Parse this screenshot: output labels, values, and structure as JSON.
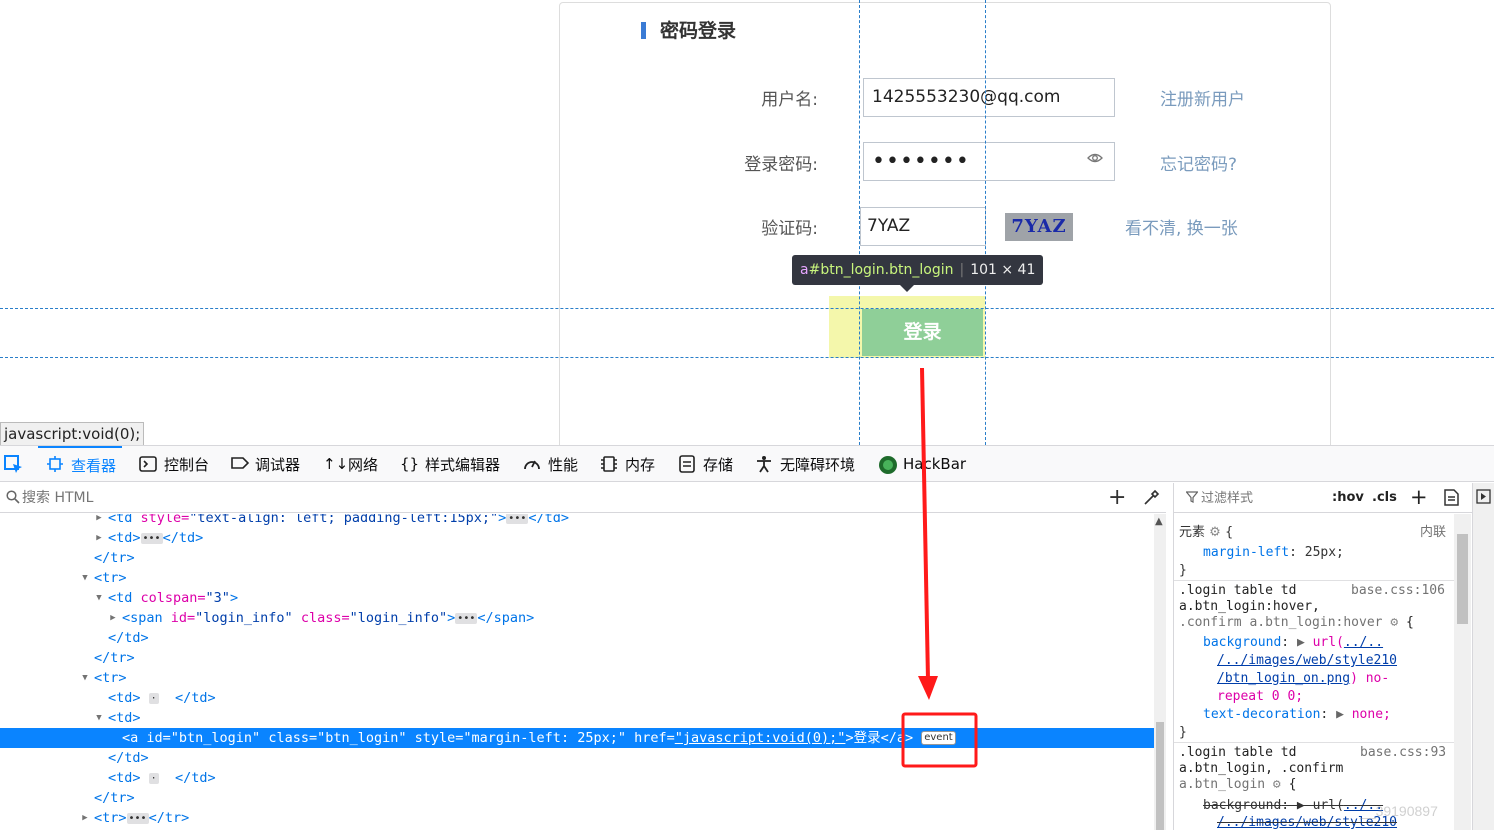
{
  "login_form": {
    "title": "密码登录",
    "username_label": "用户名:",
    "username_value": "1425553230@qq.com",
    "register_link": "注册新用户",
    "password_label": "登录密码:",
    "password_value": "•••••••",
    "forgot_link": "忘记密码?",
    "captcha_label": "验证码:",
    "captcha_value": "7YAZ",
    "captcha_image_text": "7YAZ",
    "refresh_link": "看不清, 换一张",
    "login_button": "登录"
  },
  "highlighter": {
    "tag": "a",
    "selector": "#btn_login.btn_login",
    "size": "101 × 41"
  },
  "status_url": "javascript:void(0);",
  "devtools": {
    "tabs": [
      {
        "label": "查看器",
        "icon": "inspector-icon"
      },
      {
        "label": "控制台",
        "icon": "console-icon"
      },
      {
        "label": "调试器",
        "icon": "debugger-icon"
      },
      {
        "label": "网络",
        "icon": "network-icon"
      },
      {
        "label": "样式编辑器",
        "icon": "style-editor-icon"
      },
      {
        "label": "性能",
        "icon": "performance-icon"
      },
      {
        "label": "内存",
        "icon": "memory-icon"
      },
      {
        "label": "存储",
        "icon": "storage-icon"
      },
      {
        "label": "无障碍环境",
        "icon": "accessibility-icon"
      },
      {
        "label": "HackBar",
        "icon": "hackbar-icon"
      }
    ],
    "search_placeholder": "搜索 HTML",
    "markup": {
      "l1": {
        "tag_open": "<td",
        "attr": " style=",
        "val": "\"text-align: left; padding-left:15px;\"",
        "close": ">",
        "end": "</td>"
      },
      "l2": {
        "open": "<td>",
        "end": "</td>"
      },
      "l3": "</tr>",
      "l4": "<tr>",
      "l5": {
        "tag_open": "<td",
        "attr": " colspan=",
        "val": "\"3\"",
        "close": ">"
      },
      "l6": {
        "tag_open": "<span",
        "a1": " id=",
        "v1": "\"login_info\"",
        "a2": " class=",
        "v2": "\"login_info\"",
        "close": ">",
        "end": "</span>"
      },
      "l7": "</td>",
      "l8": "</tr>",
      "l9": "<tr>",
      "l10": {
        "open": "<td>",
        "end": "</td>"
      },
      "l11": "<td>",
      "l12": {
        "tag_open": "<a",
        "a1": " id=",
        "v1": "\"btn_login\"",
        "a2": " class=",
        "v2": "\"btn_login\"",
        "a3": " style=",
        "v3": "\"margin-left: 25px;\"",
        "a4": " href=",
        "v4": "\"javascript:void(0);\"",
        "text": ">登录</a>",
        "badge": "event"
      },
      "l13": "</td>",
      "l14": {
        "open": "<td>",
        "end": "</td>"
      },
      "l15": "</tr>",
      "l16": {
        "open": "<tr>",
        "end": "</tr>"
      }
    },
    "rules": {
      "filter_placeholder": "过滤样式",
      "hov": ":hov",
      "cls": ".cls",
      "element_label": "元素",
      "inline_label": "内联",
      "r0_prop": "margin-left",
      "r0_val": "25px;",
      "r1_sel1": ".login table td",
      "r1_src": "base.css:106",
      "r1_sel2": "a.btn_login:hover,",
      "r1_sel3": ".confirm a.btn_login:hover",
      "r1_prop1": "background",
      "r1_url1": "../..",
      "r1_url2": "/../images/web/style210",
      "r1_url3": "/btn_login_on.png",
      "r1_rest1": ") no-",
      "r1_rest2": "repeat 0 0;",
      "r1_prop2": "text-decoration",
      "r1_val2": "none;",
      "r2_sel1": ".login table td",
      "r2_src": "base.css:93",
      "r2_sel2": "a.btn_login, .confirm",
      "r2_sel3": "a.btn_login",
      "r2_prop1": "background",
      "r2_url1": "../..",
      "r2_url2": "/../images/web/style210"
    }
  },
  "watermark": "__39190897",
  "colors": {
    "accent_blue": "#0a84ff",
    "login_button_green": "#8fcf98",
    "annotation_red": "#ff1a1a",
    "highlight_yellow": "#f3f7a6"
  }
}
